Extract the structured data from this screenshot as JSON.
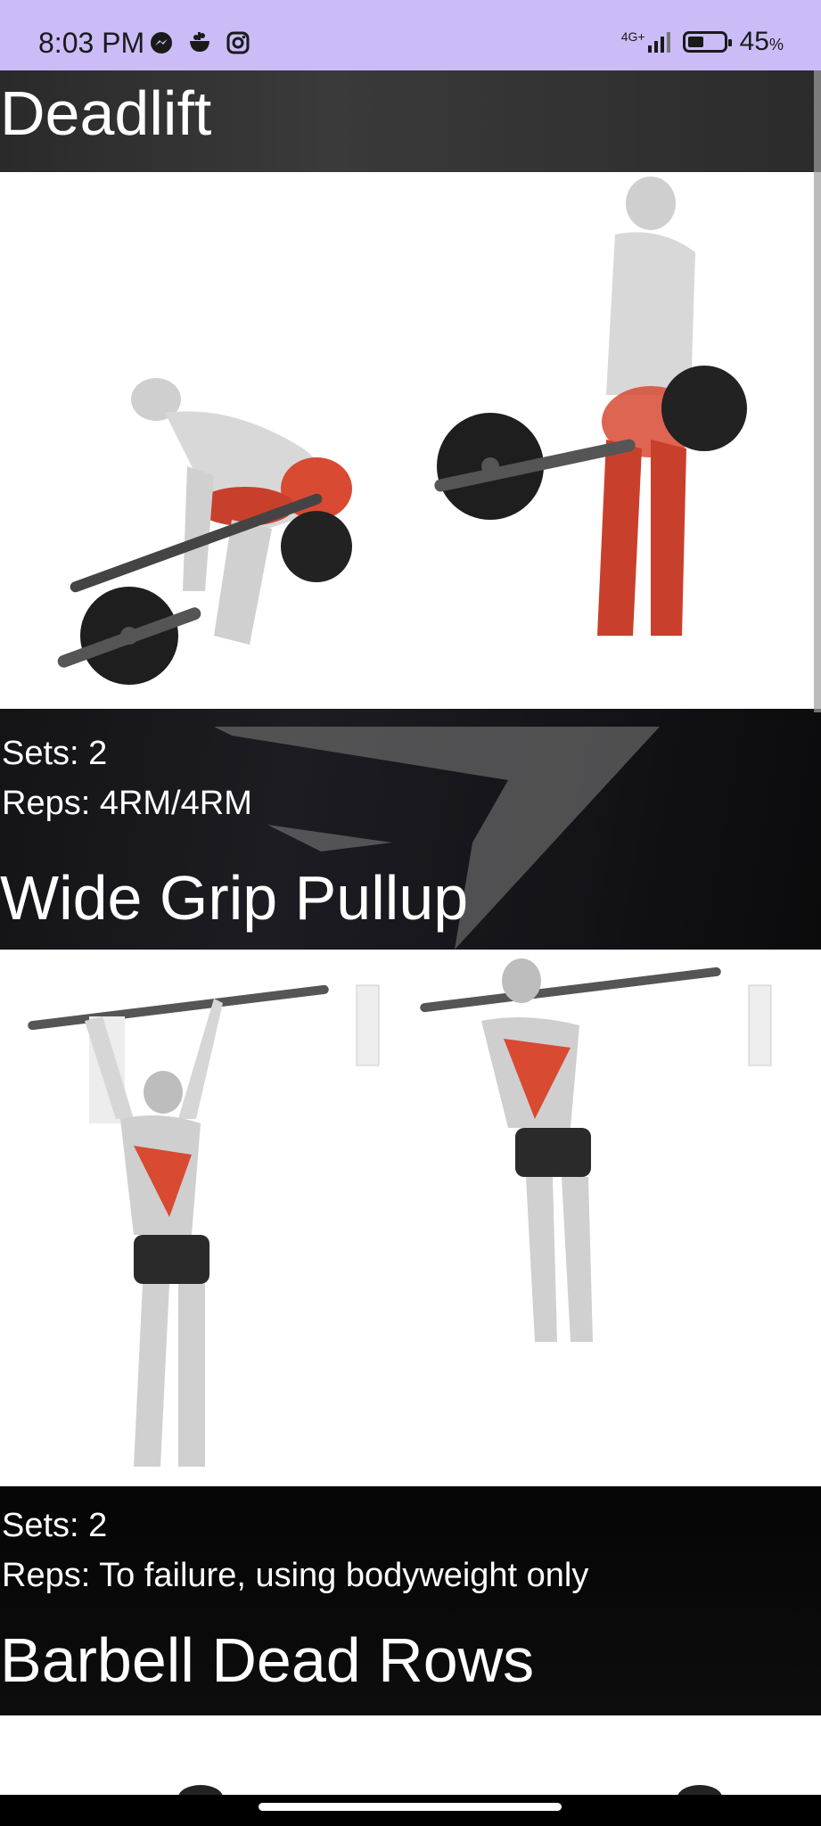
{
  "status_bar": {
    "time": "8:03 PM",
    "network": "4G+",
    "battery_percent": "45",
    "battery_unit": "%",
    "battery_level": 0.45
  },
  "exercises": [
    {
      "name": "Deadlift",
      "sets": "Sets: 2",
      "reps": "Reps: 4RM/4RM"
    },
    {
      "name": "Wide Grip Pullup",
      "sets": "Sets: 2",
      "reps": "Reps: To failure, using bodyweight only"
    },
    {
      "name": "Barbell Dead Rows"
    }
  ]
}
